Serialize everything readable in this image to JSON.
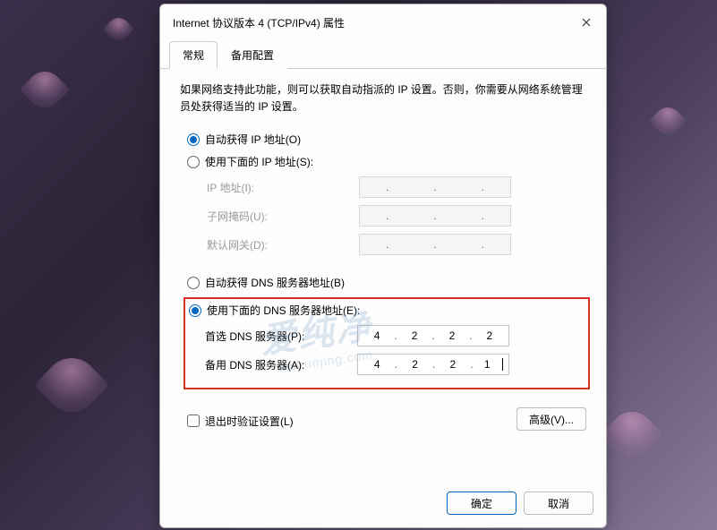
{
  "title": "Internet 协议版本 4 (TCP/IPv4) 属性",
  "tabs": {
    "general": "常规",
    "alternate": "备用配置"
  },
  "description": "如果网络支持此功能，则可以获取自动指派的 IP 设置。否则，你需要从网络系统管理员处获得适当的 IP 设置。",
  "ip": {
    "auto": "自动获得 IP 地址(O)",
    "manual": "使用下面的 IP 地址(S):",
    "address_label": "IP 地址(I):",
    "mask_label": "子网掩码(U):",
    "gateway_label": "默认网关(D):"
  },
  "dns": {
    "auto": "自动获得 DNS 服务器地址(B)",
    "manual": "使用下面的 DNS 服务器地址(E):",
    "preferred_label": "首选 DNS 服务器(P):",
    "alternate_label": "备用 DNS 服务器(A):",
    "preferred": [
      "4",
      "2",
      "2",
      "2"
    ],
    "alternate": [
      "4",
      "2",
      "2",
      "1"
    ]
  },
  "validate": "退出时验证设置(L)",
  "advanced": "高级(V)...",
  "ok": "确定",
  "cancel": "取消",
  "watermark": "爱纯净",
  "watermark_sub": "aichunjing.com"
}
